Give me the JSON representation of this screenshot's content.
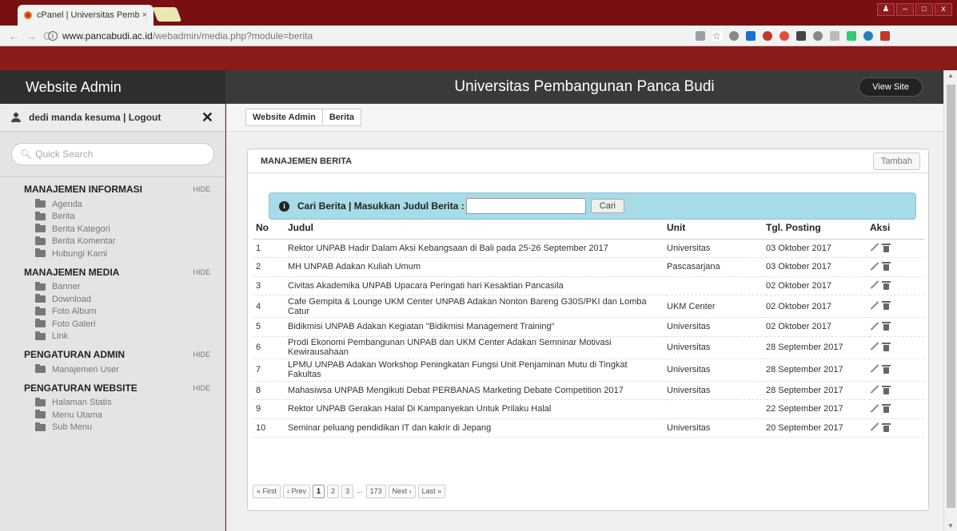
{
  "browser": {
    "tab_title": "cPanel | Universitas Pemb",
    "tab_close": "×",
    "url_host": "www.pancabudi.ac.id",
    "url_path": "/webadmin/media.php?module=berita",
    "info_glyph": "i"
  },
  "header": {
    "brand": "Website Admin",
    "site_title": "Universitas Pembangunan Panca Budi",
    "view_site": "View Site"
  },
  "sidebar": {
    "user_label": "dedi manda kesuma | Logout",
    "close_glyph": "✕",
    "search_placeholder": "Quick Search",
    "hide_label": "HIDE",
    "sections": [
      {
        "title": "MANAJEMEN INFORMASI",
        "items": [
          "Agenda",
          "Berita",
          "Berita Kategori",
          "Berita Komentar",
          "Hubungi Kami"
        ]
      },
      {
        "title": "MANAJEMEN MEDIA",
        "items": [
          "Banner",
          "Download",
          "Foto Album",
          "Foto Galeri",
          "Link"
        ]
      },
      {
        "title": "PENGATURAN ADMIN",
        "items": [
          "Manajemen User"
        ]
      },
      {
        "title": "PENGATURAN WEBSITE",
        "items": [
          "Halaman Statis",
          "Menu Utama",
          "Sub Menu"
        ]
      }
    ]
  },
  "breadcrumb": [
    "Website Admin",
    "Berita"
  ],
  "panel": {
    "title": "MANAJEMEN BERITA",
    "add_button": "Tambah",
    "search_label": "Cari Berita | Masukkan Judul Berita :",
    "search_value": "",
    "search_button": "Cari"
  },
  "table": {
    "headers": [
      "No",
      "Judul",
      "Unit",
      "Tgl. Posting",
      "Aksi"
    ],
    "rows": [
      [
        "1",
        "Rektor UNPAB Hadir Dalam Aksi Kebangsaan di Bali pada 25-26 September 2017",
        "Universitas",
        "03 Oktober 2017"
      ],
      [
        "2",
        "MH UNPAB Adakan Kuliah Umum",
        "Pascasarjana",
        "03 Oktober 2017"
      ],
      [
        "3",
        "Civitas Akademika UNPAB Upacara Peringati hari Kesaktian Pancasila",
        "",
        "02 Oktober 2017"
      ],
      [
        "4",
        "Cafe Gempita & Lounge UKM Center UNPAB Adakan Nonton Bareng G30S/PKI dan Lomba Catur",
        "UKM Center",
        "02 Oktober 2017"
      ],
      [
        "5",
        "Bidikmisi UNPAB Adakan Kegiatan \"Bidikmisi Management Training\"",
        "Universitas",
        "02 Oktober 2017"
      ],
      [
        "6",
        "Prodi Ekonomi Pembangunan UNPAB dan UKM Center Adakan Semninar Motivasi Kewirausahaan",
        "Universitas",
        "28 September 2017"
      ],
      [
        "7",
        "LPMU UNPAB Adakan Workshop Peningkatan Fungsi Unit Penjaminan Mutu di Tingkat Fakultas",
        "Universitas",
        "28 September 2017"
      ],
      [
        "8",
        "Mahasiwsa UNPAB Mengikuti Debat PERBANAS Marketing Debate Competition 2017",
        "Universitas",
        "28 September 2017"
      ],
      [
        "9",
        "Rektor UNPAB Gerakan Halal Di Kampanyekan Untuk Prilaku Halal",
        "",
        "22 September 2017"
      ],
      [
        "10",
        "Seminar peluang pendidikan IT dan kakrir di Jepang",
        "Universitas",
        "20 September 2017"
      ]
    ]
  },
  "pagination": [
    "« First",
    "‹ Prev",
    "1",
    "2",
    "3",
    "...",
    "173",
    "Next ›",
    "Last »"
  ],
  "pagination_current": "1",
  "scroll_glyphs": {
    "up": "▲",
    "down": "▼"
  }
}
